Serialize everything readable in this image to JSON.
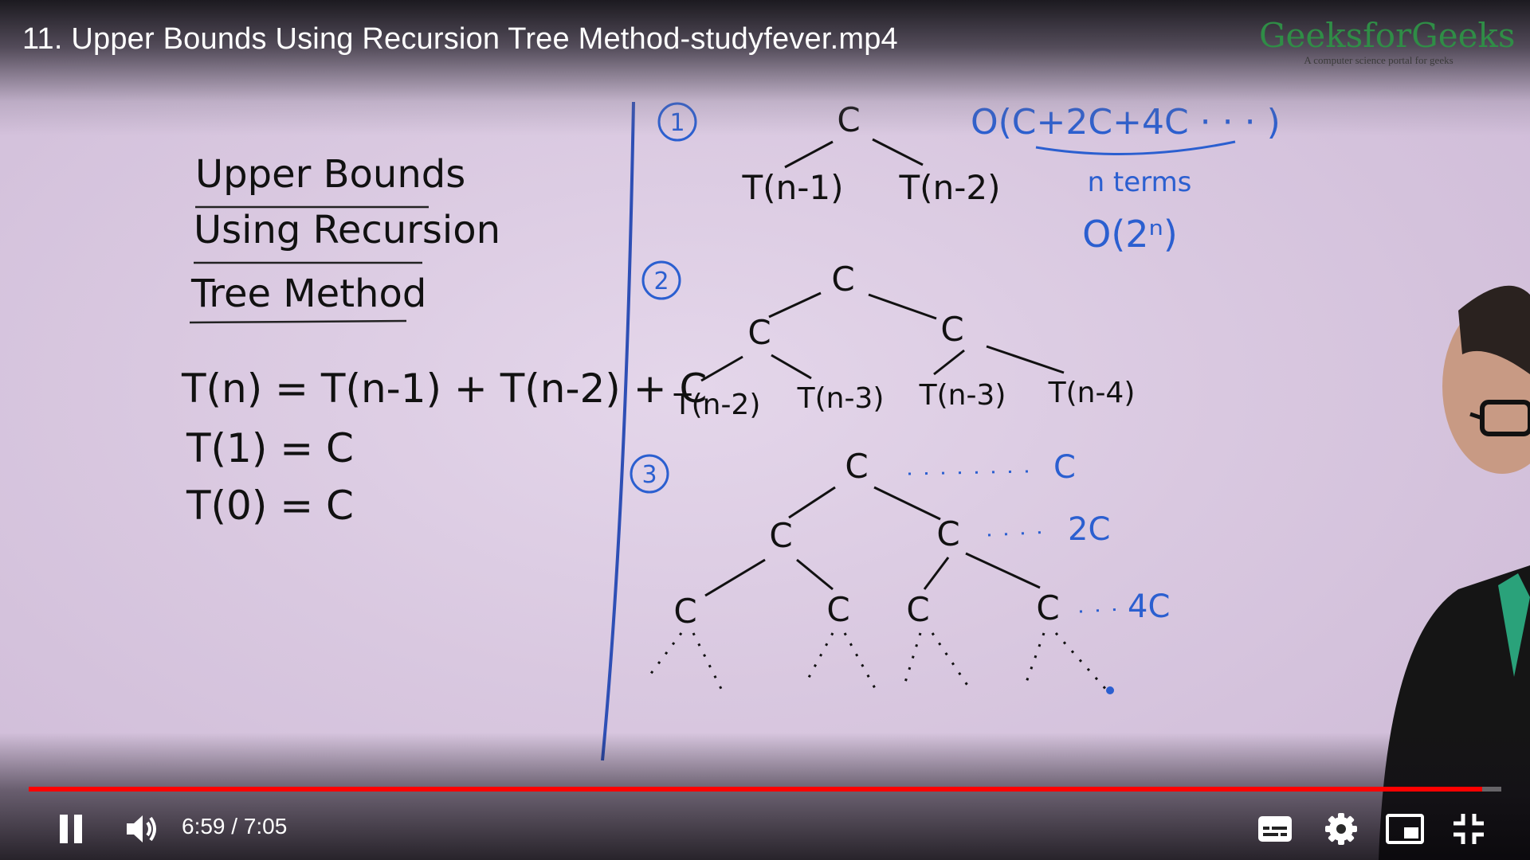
{
  "video": {
    "title": "11. Upper Bounds Using Recursion Tree Method-studyfever.mp4"
  },
  "logo": {
    "brand": "GeeksforGeeks",
    "tagline": "A computer science portal for geeks"
  },
  "board": {
    "heading_lines": [
      "Upper Bounds",
      "Using Recursion",
      "Tree Method"
    ],
    "equations": [
      "T(n) = T(n-1) + T(n-2) + C",
      "T(1) = C",
      "T(0) = C"
    ],
    "step_numbers": [
      "1",
      "2",
      "3"
    ],
    "step1": {
      "root": "C",
      "children": [
        "T(n-1)",
        "T(n-2)"
      ],
      "sum_expression": "O(C+2C+4C · · · )",
      "note": "n terms",
      "result": "O(2ⁿ)"
    },
    "step2": {
      "root": "C",
      "level1": [
        "C",
        "C"
      ],
      "level2": [
        "T(n-2)",
        "T(n-3)",
        "T(n-3)",
        "T(n-4)"
      ]
    },
    "step3": {
      "root": "C",
      "level1": [
        "C",
        "C"
      ],
      "level2": [
        "C",
        "C",
        "C",
        "C"
      ],
      "level_sums": [
        "C",
        "2C",
        "4C"
      ]
    }
  },
  "player": {
    "current_time": "6:59",
    "duration": "7:05",
    "time_text": "6:59 / 7:05",
    "progress_fraction": 0.987,
    "state": "playing",
    "icons": [
      "pause-icon",
      "volume-icon",
      "subtitles-icon",
      "settings-icon",
      "miniplayer-icon",
      "exit-fullscreen-icon"
    ],
    "colors": {
      "progress": "#ff0000",
      "ink_black": "#111111",
      "ink_blue": "#2b5fd0",
      "brand_green": "#2f8d46"
    }
  }
}
